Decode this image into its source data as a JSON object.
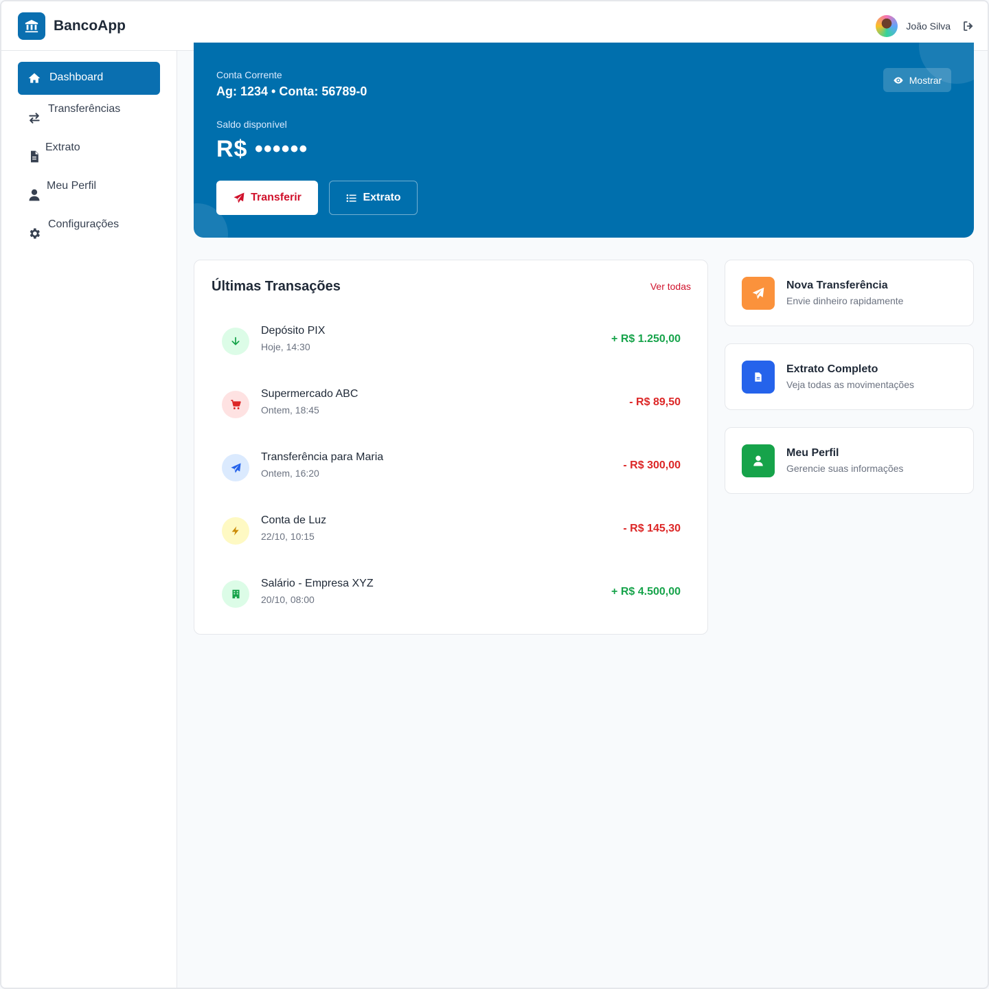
{
  "header": {
    "app_name": "BancoApp",
    "user_name": "João Silva"
  },
  "sidebar": {
    "items": [
      {
        "label": "Dashboard",
        "icon": "home-icon",
        "active": true
      },
      {
        "label": "Transferências",
        "icon": "exchange-icon",
        "active": false
      },
      {
        "label": "Extrato",
        "icon": "document-icon",
        "active": false
      },
      {
        "label": "Meu Perfil",
        "icon": "user-icon",
        "active": false
      },
      {
        "label": "Configurações",
        "icon": "gear-icon",
        "active": false
      }
    ]
  },
  "account": {
    "type": "Conta Corrente",
    "number": "Ag: 1234 • Conta: 56789-0",
    "balance_label": "Saldo disponível",
    "balance_masked": "R$ ••••••",
    "show_label": "Mostrar",
    "transfer_label": "Transferir",
    "statement_label": "Extrato"
  },
  "transactions": {
    "title": "Últimas Transações",
    "view_all": "Ver todas",
    "items": [
      {
        "name": "Depósito PIX",
        "date": "Hoje, 14:30",
        "amount": "+ R$ 1.250,00",
        "type": "credit",
        "icon": "arrow-down-icon"
      },
      {
        "name": "Supermercado ABC",
        "date": "Ontem, 18:45",
        "amount": "- R$ 89,50",
        "type": "debit",
        "icon": "cart-icon"
      },
      {
        "name": "Transferência para Maria",
        "date": "Ontem, 16:20",
        "amount": "- R$ 300,00",
        "type": "debit",
        "icon": "paper-plane-icon"
      },
      {
        "name": "Conta de Luz",
        "date": "22/10, 10:15",
        "amount": "- R$ 145,30",
        "type": "debit",
        "icon": "bolt-icon"
      },
      {
        "name": "Salário - Empresa XYZ",
        "date": "20/10, 08:00",
        "amount": "+ R$ 4.500,00",
        "type": "credit",
        "icon": "building-icon"
      }
    ]
  },
  "quick_actions": [
    {
      "title": "Nova Transferência",
      "subtitle": "Envie dinheiro rapidamente",
      "color": "#fb923c",
      "icon": "paper-plane-icon"
    },
    {
      "title": "Extrato Completo",
      "subtitle": "Veja todas as movimentações",
      "color": "#2563eb",
      "icon": "document-icon"
    },
    {
      "title": "Meu Perfil",
      "subtitle": "Gerencie suas informações",
      "color": "#16a34a",
      "icon": "user-icon"
    }
  ],
  "colors": {
    "primary": "#0a6fb0",
    "accent": "#d0112b",
    "credit": "#16a34a",
    "debit": "#dc2626"
  }
}
